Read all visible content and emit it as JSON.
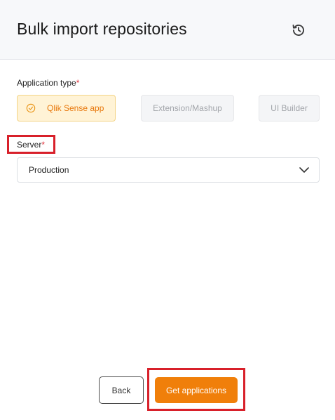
{
  "header": {
    "title": "Bulk import repositories",
    "history_icon": "history-icon"
  },
  "form": {
    "app_type": {
      "label": "Application type",
      "required_mark": "*",
      "options": [
        {
          "label": "Qlik Sense app",
          "selected": true,
          "icon": "check-circle-icon"
        },
        {
          "label": "Extension/Mashup",
          "selected": false
        },
        {
          "label": "UI Builder",
          "selected": false
        }
      ]
    },
    "server": {
      "label": "Server",
      "required_mark": "*",
      "value": "Production",
      "icon": "chevron-down-icon"
    }
  },
  "footer": {
    "back_label": "Back",
    "primary_label": "Get applications"
  },
  "colors": {
    "accent": "#f07f0a",
    "selected_bg": "#fff3d6",
    "highlight": "#d8202a",
    "required": "#e0323c"
  }
}
